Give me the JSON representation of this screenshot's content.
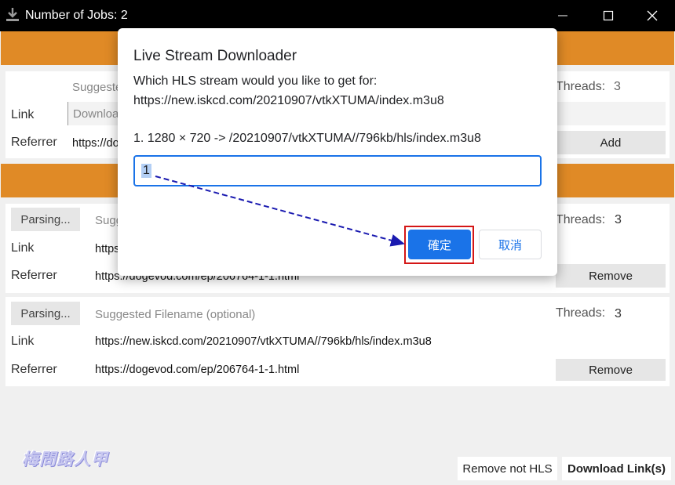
{
  "window": {
    "title": "Number of Jobs: 2"
  },
  "top_panel": {
    "filename_placeholder": "Suggeste",
    "threads_label": "Threads:",
    "threads_value": "3",
    "link_label": "Link",
    "link_placeholder": "Downloa",
    "referrer_label": "Referrer",
    "referrer_value": "https://do",
    "add_label": "Add"
  },
  "jobs": [
    {
      "parse_label": "Parsing...",
      "filename_placeholder": "Sugg",
      "threads_label": "Threads:",
      "threads_value": "3",
      "link_label": "Link",
      "link_value": "https",
      "referrer_label": "Referrer",
      "referrer_value": "https://dogevod.com/ep/206764-1-1.html",
      "remove_label": "Remove"
    },
    {
      "parse_label": "Parsing...",
      "filename_placeholder": "Suggested Filename (optional)",
      "threads_label": "Threads:",
      "threads_value": "3",
      "link_label": "Link",
      "link_value": "https://new.iskcd.com/20210907/vtkXTUMA//796kb/hls/index.m3u8",
      "referrer_label": "Referrer",
      "referrer_value": "https://dogevod.com/ep/206764-1-1.html",
      "remove_label": "Remove"
    }
  ],
  "footer": {
    "remove_not_hls": "Remove not HLS",
    "download_links": "Download Link(s)",
    "watermark": "梅問路人甲"
  },
  "dialog": {
    "title": "Live Stream Downloader",
    "question": "Which HLS stream would you like to get for:",
    "url": "https://new.iskcd.com/20210907/vtkXTUMA/index.m3u8",
    "option_1": "1. 1280 × 720 -> /20210907/vtkXTUMA//796kb/hls/index.m3u8",
    "input_value": "1",
    "ok_label": "確定",
    "cancel_label": "取消"
  },
  "colors": {
    "accent_orange": "#e08a26",
    "dialog_blue": "#1a73e8",
    "highlight_red": "#d41616"
  },
  "icons": {
    "title": "download-icon",
    "minimize": "minimize-icon",
    "maximize": "maximize-icon",
    "close": "close-icon"
  }
}
